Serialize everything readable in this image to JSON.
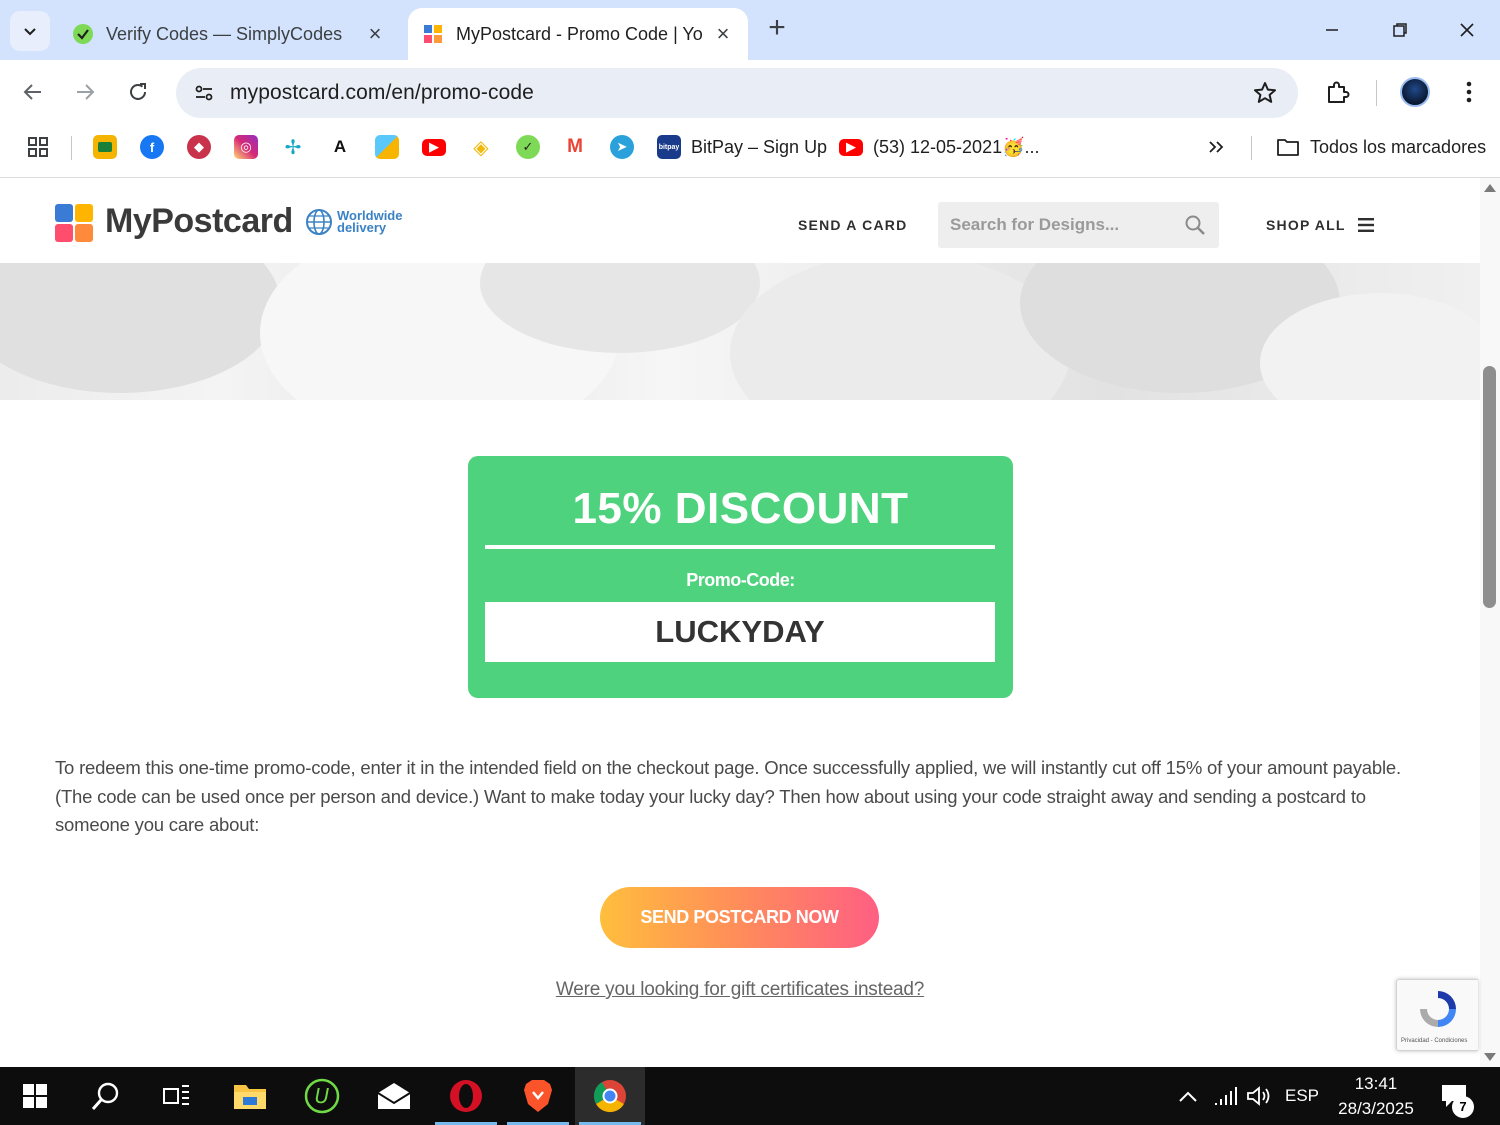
{
  "browser": {
    "tabs": [
      {
        "title": "Verify Codes — SimplyCodes",
        "active": false,
        "favicon": "simplycodes-icon"
      },
      {
        "title": "MyPostcard - Promo Code | You",
        "active": true,
        "favicon": "mypostcard-icon"
      }
    ],
    "address_bar": {
      "url": "mypostcard.com/en/promo-code"
    },
    "bookmarks": [
      {
        "label": "",
        "icon": "google-classroom-icon"
      },
      {
        "label": "",
        "icon": "facebook-icon"
      },
      {
        "label": "",
        "icon": "cube-icon"
      },
      {
        "label": "",
        "icon": "instagram-icon"
      },
      {
        "label": "",
        "icon": "pinwheel-icon"
      },
      {
        "label": "",
        "icon": "a-logo-icon"
      },
      {
        "label": "",
        "icon": "puzzle-app-icon"
      },
      {
        "label": "",
        "icon": "youtube-icon"
      },
      {
        "label": "",
        "icon": "binance-icon"
      },
      {
        "label": "",
        "icon": "simplycodes-icon"
      },
      {
        "label": "",
        "icon": "gmail-icon"
      },
      {
        "label": "",
        "icon": "telegram-icon"
      },
      {
        "label": "BitPay – Sign Up",
        "icon": "bitpay-icon"
      },
      {
        "label": "(53) 12-05-2021🥳...",
        "icon": "youtube-icon"
      }
    ],
    "all_bookmarks_label": "Todos los marcadores"
  },
  "site": {
    "logo_text": "MyPostcard",
    "worldwide_line1": "Worldwide",
    "worldwide_line2": "delivery",
    "nav_send_card": "SEND A CARD",
    "search_placeholder": "Search for Designs...",
    "nav_shop_all": "SHOP ALL"
  },
  "promo": {
    "title": "15% DISCOUNT",
    "code_label": "Promo-Code:",
    "code": "LUCKYDAY"
  },
  "description": "To redeem this one-time promo-code, enter it in the intended field on the checkout page. Once successfully applied, we will instantly cut off 15% of your amount payable. (The code can be used once per person and device.) Want to make today your lucky day? Then how about using your code straight away and sending a postcard to someone you care about:",
  "cta_label": "SEND POSTCARD NOW",
  "gift_link": "Were you looking for gift certificates instead?",
  "recaptcha_text": "Privacidad - Condiciones",
  "taskbar": {
    "language": "ESP",
    "time": "13:41",
    "date": "28/3/2025",
    "notification_count": "7"
  },
  "colors": {
    "promo_green": "#4fd27e",
    "cta_start": "#ffbe3d",
    "cta_end": "#ff5f83",
    "chrome_tabstrip": "#d3e3fd"
  }
}
